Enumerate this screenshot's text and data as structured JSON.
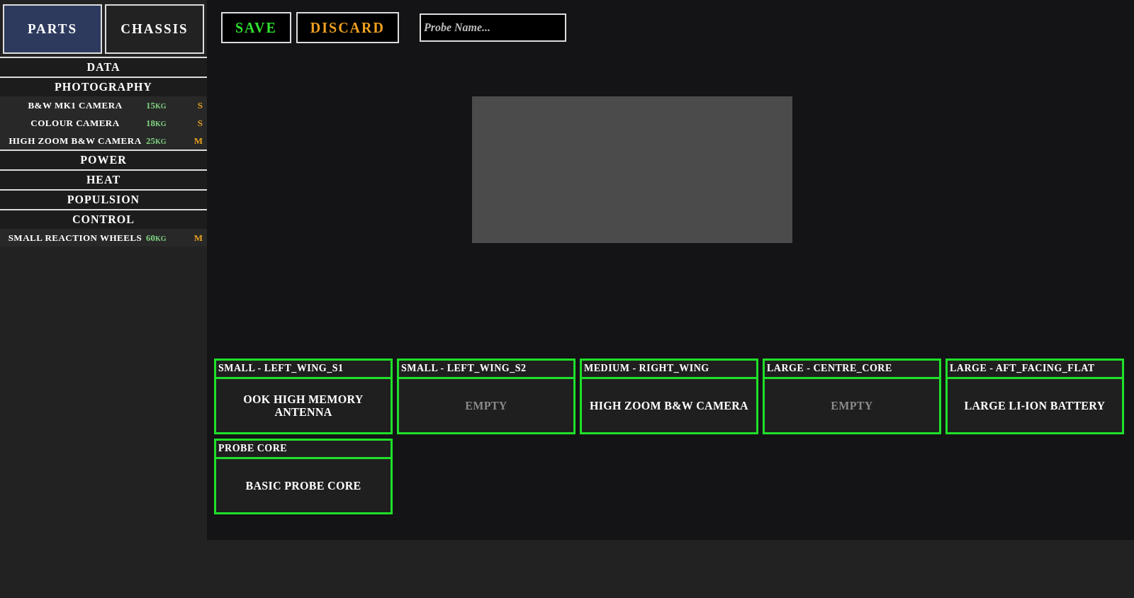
{
  "tabs": [
    {
      "label": "PARTS",
      "selected": true
    },
    {
      "label": "CHASSIS",
      "selected": false
    }
  ],
  "categories": [
    {
      "name": "DATA"
    },
    {
      "name": "PHOTOGRAPHY",
      "items": [
        {
          "name": "B&W MK1 CAMERA",
          "mass": "15",
          "unit": "KG",
          "size": "S"
        },
        {
          "name": "COLOUR CAMERA",
          "mass": "18",
          "unit": "KG",
          "size": "S"
        },
        {
          "name": "HIGH ZOOM B&W CAMERA",
          "mass": "25",
          "unit": "KG",
          "size": "M"
        }
      ]
    },
    {
      "name": "POWER"
    },
    {
      "name": "HEAT"
    },
    {
      "name": "POPULSION"
    },
    {
      "name": "CONTROL",
      "items": [
        {
          "name": "SMALL REACTION WHEELS",
          "mass": "60",
          "unit": "KG",
          "size": "M"
        }
      ]
    }
  ],
  "toolbar": {
    "save": "SAVE",
    "discard": "DISCARD",
    "name_field": {
      "placeholder": "Probe Name..."
    }
  },
  "slots": [
    {
      "label": "SMALL - LEFT_WING_S1",
      "content": "OOK HIGH MEMORY ANTENNA",
      "empty": false
    },
    {
      "label": "SMALL - LEFT_WING_S2",
      "content": "EMPTY",
      "empty": true
    },
    {
      "label": "MEDIUM - RIGHT_WING",
      "content": "HIGH ZOOM B&W CAMERA",
      "empty": false
    },
    {
      "label": "LARGE - CENTRE_CORE",
      "content": "EMPTY",
      "empty": true
    },
    {
      "label": "LARGE - AFT_FACING_FLAT",
      "content": "LARGE LI-ION BATTERY",
      "empty": false
    },
    {
      "label": "PROBE CORE",
      "content": "BASIC PROBE CORE",
      "empty": false
    }
  ]
}
